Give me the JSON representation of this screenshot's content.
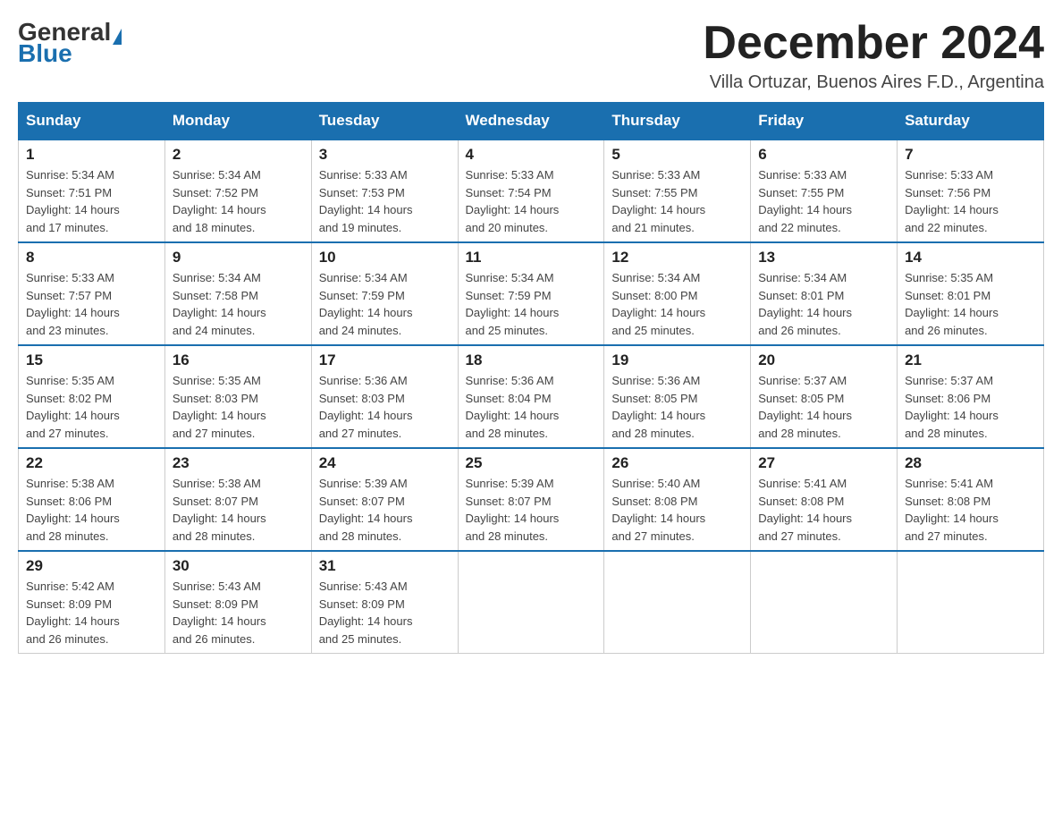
{
  "header": {
    "logo_general": "General",
    "logo_blue": "Blue",
    "month_year": "December 2024",
    "location": "Villa Ortuzar, Buenos Aires F.D., Argentina"
  },
  "days_of_week": [
    "Sunday",
    "Monday",
    "Tuesday",
    "Wednesday",
    "Thursday",
    "Friday",
    "Saturday"
  ],
  "weeks": [
    [
      {
        "day": "1",
        "sunrise": "5:34 AM",
        "sunset": "7:51 PM",
        "daylight": "14 hours and 17 minutes."
      },
      {
        "day": "2",
        "sunrise": "5:34 AM",
        "sunset": "7:52 PM",
        "daylight": "14 hours and 18 minutes."
      },
      {
        "day": "3",
        "sunrise": "5:33 AM",
        "sunset": "7:53 PM",
        "daylight": "14 hours and 19 minutes."
      },
      {
        "day": "4",
        "sunrise": "5:33 AM",
        "sunset": "7:54 PM",
        "daylight": "14 hours and 20 minutes."
      },
      {
        "day": "5",
        "sunrise": "5:33 AM",
        "sunset": "7:55 PM",
        "daylight": "14 hours and 21 minutes."
      },
      {
        "day": "6",
        "sunrise": "5:33 AM",
        "sunset": "7:55 PM",
        "daylight": "14 hours and 22 minutes."
      },
      {
        "day": "7",
        "sunrise": "5:33 AM",
        "sunset": "7:56 PM",
        "daylight": "14 hours and 22 minutes."
      }
    ],
    [
      {
        "day": "8",
        "sunrise": "5:33 AM",
        "sunset": "7:57 PM",
        "daylight": "14 hours and 23 minutes."
      },
      {
        "day": "9",
        "sunrise": "5:34 AM",
        "sunset": "7:58 PM",
        "daylight": "14 hours and 24 minutes."
      },
      {
        "day": "10",
        "sunrise": "5:34 AM",
        "sunset": "7:59 PM",
        "daylight": "14 hours and 24 minutes."
      },
      {
        "day": "11",
        "sunrise": "5:34 AM",
        "sunset": "7:59 PM",
        "daylight": "14 hours and 25 minutes."
      },
      {
        "day": "12",
        "sunrise": "5:34 AM",
        "sunset": "8:00 PM",
        "daylight": "14 hours and 25 minutes."
      },
      {
        "day": "13",
        "sunrise": "5:34 AM",
        "sunset": "8:01 PM",
        "daylight": "14 hours and 26 minutes."
      },
      {
        "day": "14",
        "sunrise": "5:35 AM",
        "sunset": "8:01 PM",
        "daylight": "14 hours and 26 minutes."
      }
    ],
    [
      {
        "day": "15",
        "sunrise": "5:35 AM",
        "sunset": "8:02 PM",
        "daylight": "14 hours and 27 minutes."
      },
      {
        "day": "16",
        "sunrise": "5:35 AM",
        "sunset": "8:03 PM",
        "daylight": "14 hours and 27 minutes."
      },
      {
        "day": "17",
        "sunrise": "5:36 AM",
        "sunset": "8:03 PM",
        "daylight": "14 hours and 27 minutes."
      },
      {
        "day": "18",
        "sunrise": "5:36 AM",
        "sunset": "8:04 PM",
        "daylight": "14 hours and 28 minutes."
      },
      {
        "day": "19",
        "sunrise": "5:36 AM",
        "sunset": "8:05 PM",
        "daylight": "14 hours and 28 minutes."
      },
      {
        "day": "20",
        "sunrise": "5:37 AM",
        "sunset": "8:05 PM",
        "daylight": "14 hours and 28 minutes."
      },
      {
        "day": "21",
        "sunrise": "5:37 AM",
        "sunset": "8:06 PM",
        "daylight": "14 hours and 28 minutes."
      }
    ],
    [
      {
        "day": "22",
        "sunrise": "5:38 AM",
        "sunset": "8:06 PM",
        "daylight": "14 hours and 28 minutes."
      },
      {
        "day": "23",
        "sunrise": "5:38 AM",
        "sunset": "8:07 PM",
        "daylight": "14 hours and 28 minutes."
      },
      {
        "day": "24",
        "sunrise": "5:39 AM",
        "sunset": "8:07 PM",
        "daylight": "14 hours and 28 minutes."
      },
      {
        "day": "25",
        "sunrise": "5:39 AM",
        "sunset": "8:07 PM",
        "daylight": "14 hours and 28 minutes."
      },
      {
        "day": "26",
        "sunrise": "5:40 AM",
        "sunset": "8:08 PM",
        "daylight": "14 hours and 27 minutes."
      },
      {
        "day": "27",
        "sunrise": "5:41 AM",
        "sunset": "8:08 PM",
        "daylight": "14 hours and 27 minutes."
      },
      {
        "day": "28",
        "sunrise": "5:41 AM",
        "sunset": "8:08 PM",
        "daylight": "14 hours and 27 minutes."
      }
    ],
    [
      {
        "day": "29",
        "sunrise": "5:42 AM",
        "sunset": "8:09 PM",
        "daylight": "14 hours and 26 minutes."
      },
      {
        "day": "30",
        "sunrise": "5:43 AM",
        "sunset": "8:09 PM",
        "daylight": "14 hours and 26 minutes."
      },
      {
        "day": "31",
        "sunrise": "5:43 AM",
        "sunset": "8:09 PM",
        "daylight": "14 hours and 25 minutes."
      },
      null,
      null,
      null,
      null
    ]
  ],
  "labels": {
    "sunrise": "Sunrise:",
    "sunset": "Sunset:",
    "daylight": "Daylight:"
  },
  "colors": {
    "header_bg": "#1a6faf",
    "accent": "#1a6faf"
  }
}
